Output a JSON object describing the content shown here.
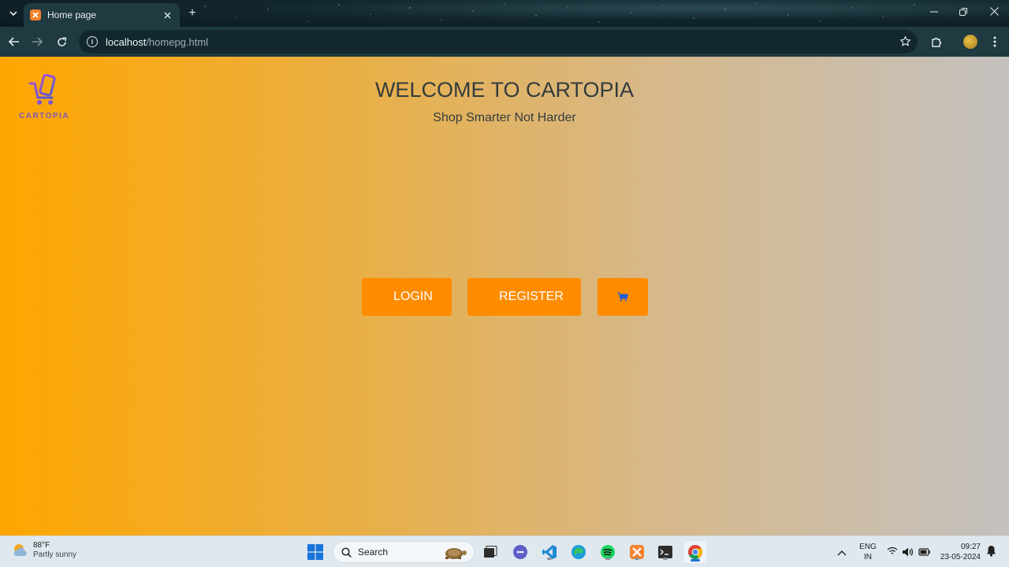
{
  "browser": {
    "tab_title": "Home page",
    "new_tab": "+",
    "url_host": "localhost",
    "url_path": "/homepg.html"
  },
  "page": {
    "logo_text": "CARTOPIA",
    "title": "WELCOME TO CARTOPIA",
    "subtitle": "Shop Smarter Not Harder",
    "login_label": "LOGIN",
    "register_label": "REGISTER",
    "accent_color": "#ff8c00",
    "cart_icon_color": "#1e5fd6",
    "logo_color": "#7e5ab8"
  },
  "taskbar": {
    "weather_temp": "88°F",
    "weather_desc": "Partly sunny",
    "search_label": "Search",
    "lang_line1": "ENG",
    "lang_line2": "IN",
    "time": "09:27",
    "date": "23-05-2024"
  }
}
